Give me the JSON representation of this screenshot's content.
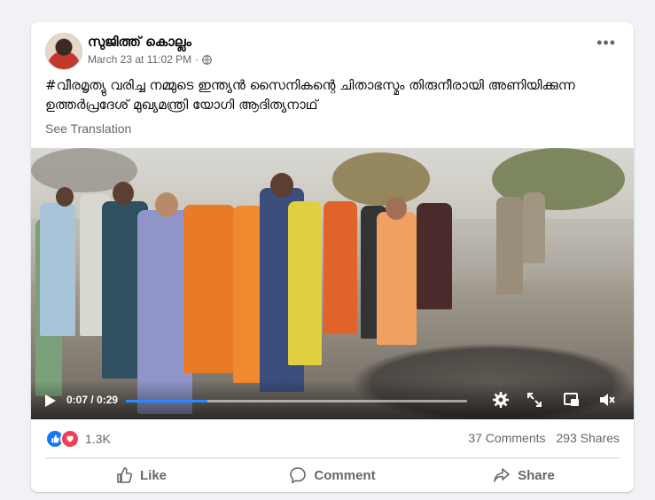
{
  "post": {
    "author": "സുജിത്ത് കൊല്ലം",
    "timestamp": "March 23 at 11:02 PM",
    "text": "#വീരമൃത്യു വരിച്ച നമ്മുടെ ഇന്ത്യൻ സൈനികന്റെ  ചിതാഭസ്മം തിരുനീരായി അണിയിക്കുന്ന ഉത്തർപ്രദേശ് മുഖ്യമന്ത്രി യോഗി ആദിത്യനാഥ്",
    "see_translation": "See Translation"
  },
  "video": {
    "current_time": "0:07",
    "duration": "0:29",
    "time_display": "0:07 / 0:29",
    "progress": 0.24
  },
  "stats": {
    "reactions_count": "1.3K",
    "comments": "37 Comments",
    "shares": "293 Shares"
  },
  "actions": {
    "like": "Like",
    "comment": "Comment",
    "share": "Share"
  },
  "colors": {
    "accent": "#1877f2",
    "love": "#f33e58",
    "muted_text": "#65676b",
    "background": "#f0f2f5"
  },
  "icons": [
    "globe-icon",
    "more-options-icon",
    "play-icon",
    "settings-icon",
    "fullscreen-icon",
    "picture-in-picture-icon",
    "volume-icon",
    "like-reaction-icon",
    "love-reaction-icon",
    "like-icon",
    "comment-icon",
    "share-icon"
  ]
}
